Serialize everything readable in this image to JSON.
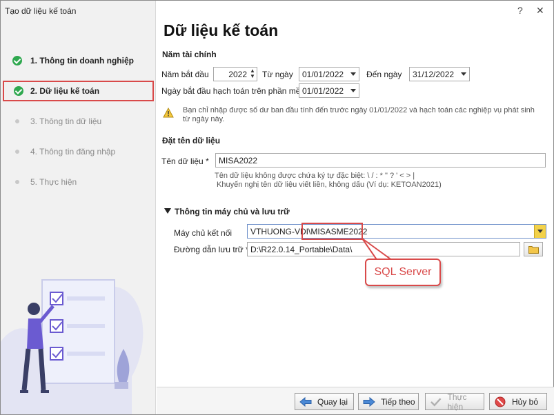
{
  "window": {
    "title": "Tạo dữ liệu kế toán",
    "help": "?",
    "close": "✕"
  },
  "steps": [
    {
      "label": "1. Thông tin doanh nghiệp",
      "state": "done"
    },
    {
      "label": "2. Dữ liệu kế toán",
      "state": "done-active"
    },
    {
      "label": "3. Thông tin dữ liệu",
      "state": "todo"
    },
    {
      "label": "4. Thông tin đăng nhập",
      "state": "todo"
    },
    {
      "label": "5. Thực hiện",
      "state": "todo"
    }
  ],
  "main": {
    "title": "Dữ liệu kế toán",
    "fiscal": {
      "section": "Năm tài chính",
      "start_year_label": "Năm bắt đầu",
      "start_year": "2022",
      "from_label": "Từ ngày",
      "from": "01/01/2022",
      "to_label": "Đến ngày",
      "to": "31/12/2022",
      "soft_start_label": "Ngày bắt đầu hạch toán trên phần mềm",
      "soft_start": "01/01/2022",
      "warning": "Bạn chỉ nhập được số dư ban đầu tính đến trước ngày 01/01/2022 và hạch toán các nghiệp vụ phát sinh từ ngày này."
    },
    "naming": {
      "section": "Đặt tên dữ liệu",
      "name_label": "Tên dữ liệu *",
      "name_value": "MISA2022",
      "hint1": "Tên dữ liệu không được chứa ký tự đặc biệt: \\ / : * \" ? ' < > |",
      "hint2": "Khuyến nghị tên dữ liệu viết liền, không dấu (Ví dụ: KETOAN2021)"
    },
    "server": {
      "section": "Thông tin máy chủ và lưu trữ",
      "server_label": "Máy chủ kết nối",
      "server_prefix": "VTHUONG-VDI\\",
      "server_instance": "MISASME2022",
      "path_label": "Đường dẫn lưu trữ *",
      "path_value": "D:\\R22.0.14_Portable\\Data\\",
      "callout": "SQL Server"
    }
  },
  "footer": {
    "back": "Quay lại",
    "next": "Tiếp theo",
    "finish": "Thực hiện",
    "cancel": "Hủy bỏ"
  },
  "colors": {
    "accent_red": "#d94a4a",
    "done_green": "#2fa84f",
    "combo_yellow": "#f3d24a",
    "illustration_purple": "#6b5bd1"
  }
}
